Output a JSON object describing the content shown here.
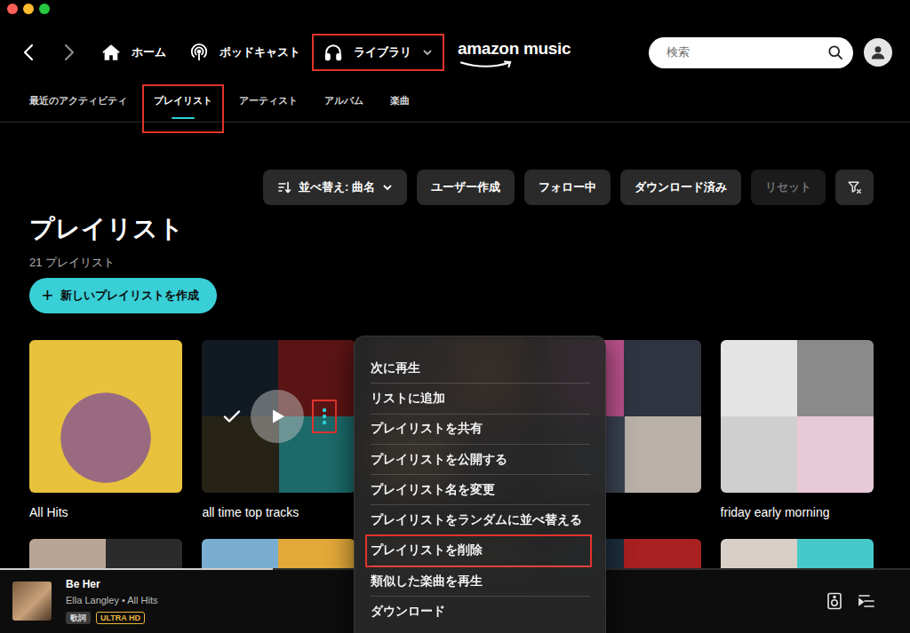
{
  "window": {
    "controls": [
      {
        "color": "#ff5f57"
      },
      {
        "color": "#febc2e"
      },
      {
        "color": "#28c840"
      }
    ]
  },
  "nav": {
    "back": {
      "disabled": false
    },
    "forward": {
      "disabled": true
    },
    "items": [
      {
        "label": "ホーム",
        "highlighted": false,
        "has_menu": false
      },
      {
        "label": "ポッドキャスト",
        "highlighted": false,
        "has_menu": false
      },
      {
        "label": "ライブラリ",
        "highlighted": true,
        "has_menu": true
      }
    ]
  },
  "logo": "amazon music",
  "search": {
    "placeholder": "検索"
  },
  "tabs": [
    {
      "label": "最近のアクティビティ",
      "selected": false,
      "highlighted": false
    },
    {
      "label": "プレイリスト",
      "selected": true,
      "highlighted": true
    },
    {
      "label": "アーティスト",
      "selected": false,
      "highlighted": false
    },
    {
      "label": "アルバム",
      "selected": false,
      "highlighted": false
    },
    {
      "label": "楽曲",
      "selected": false,
      "highlighted": false
    }
  ],
  "sort": {
    "label": "並べ替え: 曲名"
  },
  "filters": [
    {
      "label": "ユーザー作成",
      "selected": false
    },
    {
      "label": "フォロー中",
      "selected": false
    },
    {
      "label": "ダウンロード済み",
      "selected": false
    }
  ],
  "reset": {
    "label": "リセット",
    "disabled": true
  },
  "page": {
    "title": "プレイリスト",
    "count": "21 プレイリスト"
  },
  "create_button": {
    "icon": "+",
    "label": "新しいプレイリストを作成"
  },
  "playlists": [
    {
      "title": "All Hits",
      "hover": false
    },
    {
      "title": "all time top tracks",
      "hover": true,
      "more_highlighted": true
    },
    {
      "hover": false
    },
    {
      "hover": false
    },
    {
      "title": "friday early morning",
      "hover": false
    },
    {
      "hover": false
    },
    {
      "hover": false
    },
    {
      "hover": false
    },
    {
      "hover": false
    },
    {
      "hover": false
    }
  ],
  "context_menu": {
    "items": [
      {
        "label": "次に再生",
        "highlighted": false
      },
      {
        "label": "リストに追加",
        "highlighted": false
      },
      {
        "label": "プレイリストを共有",
        "highlighted": false
      },
      {
        "label": "プレイリストを公開する",
        "highlighted": false
      },
      {
        "label": "プレイリスト名を変更",
        "highlighted": false
      },
      {
        "label": "プレイリストをランダムに並べ替える",
        "highlighted": false
      },
      {
        "label": "プレイリストを削除",
        "highlighted": true
      },
      {
        "label": "類似した楽曲を再生",
        "highlighted": false
      },
      {
        "label": "ダウンロード",
        "highlighted": false
      }
    ]
  },
  "player": {
    "title": "Be Her",
    "subtitle": "Ella Langley • All Hits",
    "progress": 0.3,
    "badges": [
      {
        "label": "歌詞",
        "kind": "plain"
      },
      {
        "label": "ULTRA HD",
        "kind": "gold"
      }
    ]
  }
}
